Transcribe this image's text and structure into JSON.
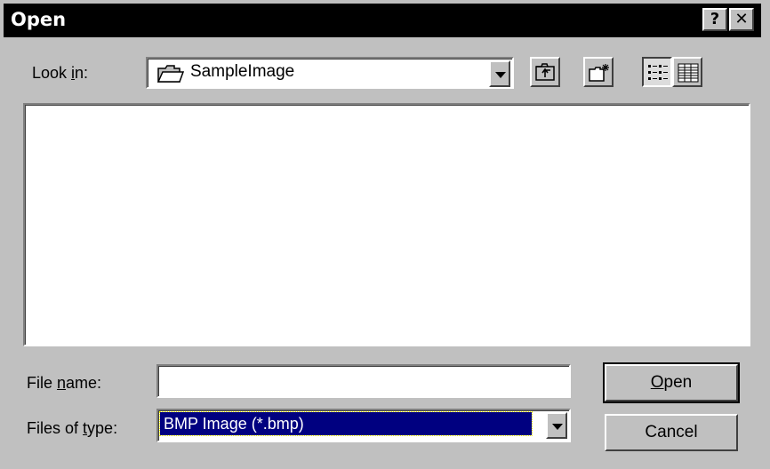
{
  "window": {
    "title": "Open",
    "help_label": "?",
    "close_label": "✕"
  },
  "lookin": {
    "label_pre": "Look ",
    "label_accel": "i",
    "label_post": "n:",
    "folder_name": "SampleImage",
    "folder_icon": "folder-icon"
  },
  "toolbar": {
    "up_one_level_icon": "up-folder-icon",
    "new_folder_icon": "new-folder-icon",
    "list_view_icon": "list-view-icon",
    "details_view_icon": "details-view-icon"
  },
  "file_list": {
    "items": []
  },
  "filename": {
    "label_pre": "File ",
    "label_accel": "n",
    "label_post": "ame:",
    "value": ""
  },
  "filetype": {
    "label_pre": "Files of ",
    "label_accel": "t",
    "label_post": "ype:",
    "selected": "BMP Image (*.bmp)"
  },
  "buttons": {
    "open_accel": "O",
    "open_rest": "pen",
    "cancel": "Cancel"
  },
  "colors": {
    "face": "#c0c0c0",
    "titlebar": "#000000",
    "selection": "#000080"
  }
}
